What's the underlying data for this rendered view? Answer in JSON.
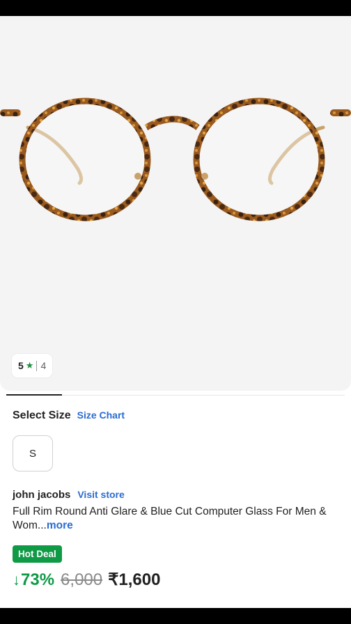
{
  "product": {
    "rating": {
      "value": "5",
      "count": "4"
    },
    "size_section": {
      "title": "Select Size",
      "size_chart_label": "Size Chart",
      "options": [
        "S"
      ]
    },
    "brand": {
      "name": "john jacobs",
      "visit_store_label": "Visit store"
    },
    "title": {
      "text": "Full Rim Round Anti Glare & Blue Cut Computer Glass For Men & Wom...",
      "more_label": "more"
    },
    "badge": "Hot Deal",
    "pricing": {
      "discount": "73%",
      "mrp": "6,000",
      "price": "₹1,600"
    }
  },
  "colors": {
    "accent_blue": "#2a6bd1",
    "deal_green": "#0f9a46",
    "frame_tortoise": "#7a4a1c",
    "temple_gold": "#c9a26a"
  },
  "icons": {
    "rating_star": "star-icon",
    "discount_arrow": "down-arrow-icon"
  }
}
